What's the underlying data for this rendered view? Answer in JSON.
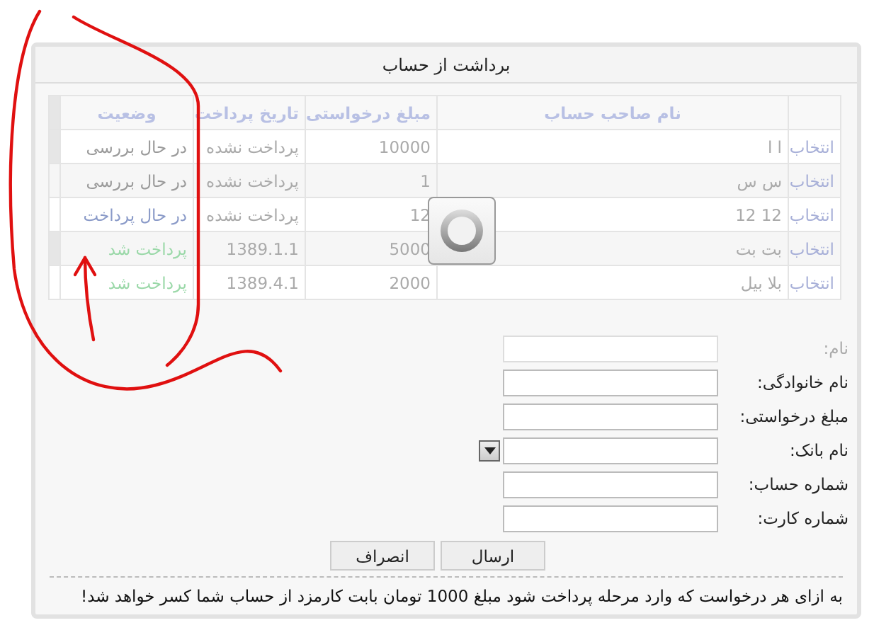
{
  "window": {
    "title": "برداشت از حساب"
  },
  "table": {
    "columns": [
      "نام صاحب حساب",
      "مبلغ درخواستی",
      "تاریخ پرداخت",
      "وضعیت"
    ],
    "rows": [
      {
        "select": "انتخاب",
        "name": "ا ا",
        "amount": "10000",
        "date": "پرداخت نشده",
        "status": "در حال بررسی",
        "color": "#9a9a9a"
      },
      {
        "select": "انتخاب",
        "name": "س س",
        "amount": "1",
        "date": "پرداخت نشده",
        "status": "در حال بررسی",
        "color": "#9a9a9a"
      },
      {
        "select": "انتخاب",
        "name": "12 12",
        "amount": "12",
        "date": "پرداخت نشده",
        "status": "در حال پرداخت",
        "color": "#8a9ac8"
      },
      {
        "select": "انتخاب",
        "name": "بت بت",
        "amount": "5000",
        "date": "1389.1.1",
        "status": "پرداخت شد",
        "color": "#9ad8a8"
      },
      {
        "select": "انتخاب",
        "name": "بلا بیل",
        "amount": "2000",
        "date": "1389.4.1",
        "status": "پرداخت شد",
        "color": "#9ad8a8"
      }
    ]
  },
  "form": {
    "fields": [
      {
        "label": "نام:",
        "kind": "text",
        "disabled": true
      },
      {
        "label": "نام خانوادگی:",
        "kind": "text",
        "disabled": false
      },
      {
        "label": "مبلغ درخواستی:",
        "kind": "text",
        "disabled": false
      },
      {
        "label": "نام بانک:",
        "kind": "select",
        "disabled": false
      },
      {
        "label": "شماره حساب:",
        "kind": "text",
        "disabled": false
      },
      {
        "label": "شماره کارت:",
        "kind": "text",
        "disabled": false
      }
    ]
  },
  "buttons": [
    "ارسال",
    "انصراف"
  ],
  "note": "به ازای هر درخواست که وارد مرحله پرداخت شود مبلغ 1000 تومان بابت کارمزد از حساب شما کسر خواهد شد!"
}
